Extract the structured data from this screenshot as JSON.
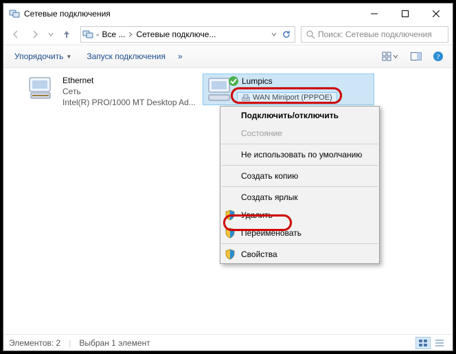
{
  "window": {
    "title": "Сетевые подключения"
  },
  "nav": {
    "crumb1": "Все ...",
    "crumb2": "Сетевые подключе...",
    "sep": "«"
  },
  "search": {
    "placeholder": "Поиск: Сетевые подключения"
  },
  "toolbar": {
    "organize": "Упорядочить",
    "start_conn": "Запуск подключения",
    "overflow": "»"
  },
  "items": [
    {
      "name": "Ethernet",
      "line2": "Сеть",
      "line3": "Intel(R) PRO/1000 MT Desktop Ad..."
    },
    {
      "name": "Lumpics",
      "line2": "",
      "line3": "WAN Miniport (PPPOE)"
    }
  ],
  "miniport_label": "WAN Miniport (PPPOE)",
  "menu": {
    "connect": "Подключить/отключить",
    "state": "Состояние",
    "nodefault": "Не использовать по умолчанию",
    "copy": "Создать копию",
    "shortcut": "Создать ярлык",
    "delete": "Удалить",
    "rename": "Переименовать",
    "props": "Свойства"
  },
  "status": {
    "elements": "Элементов: 2",
    "selected": "Выбран 1 элемент"
  }
}
